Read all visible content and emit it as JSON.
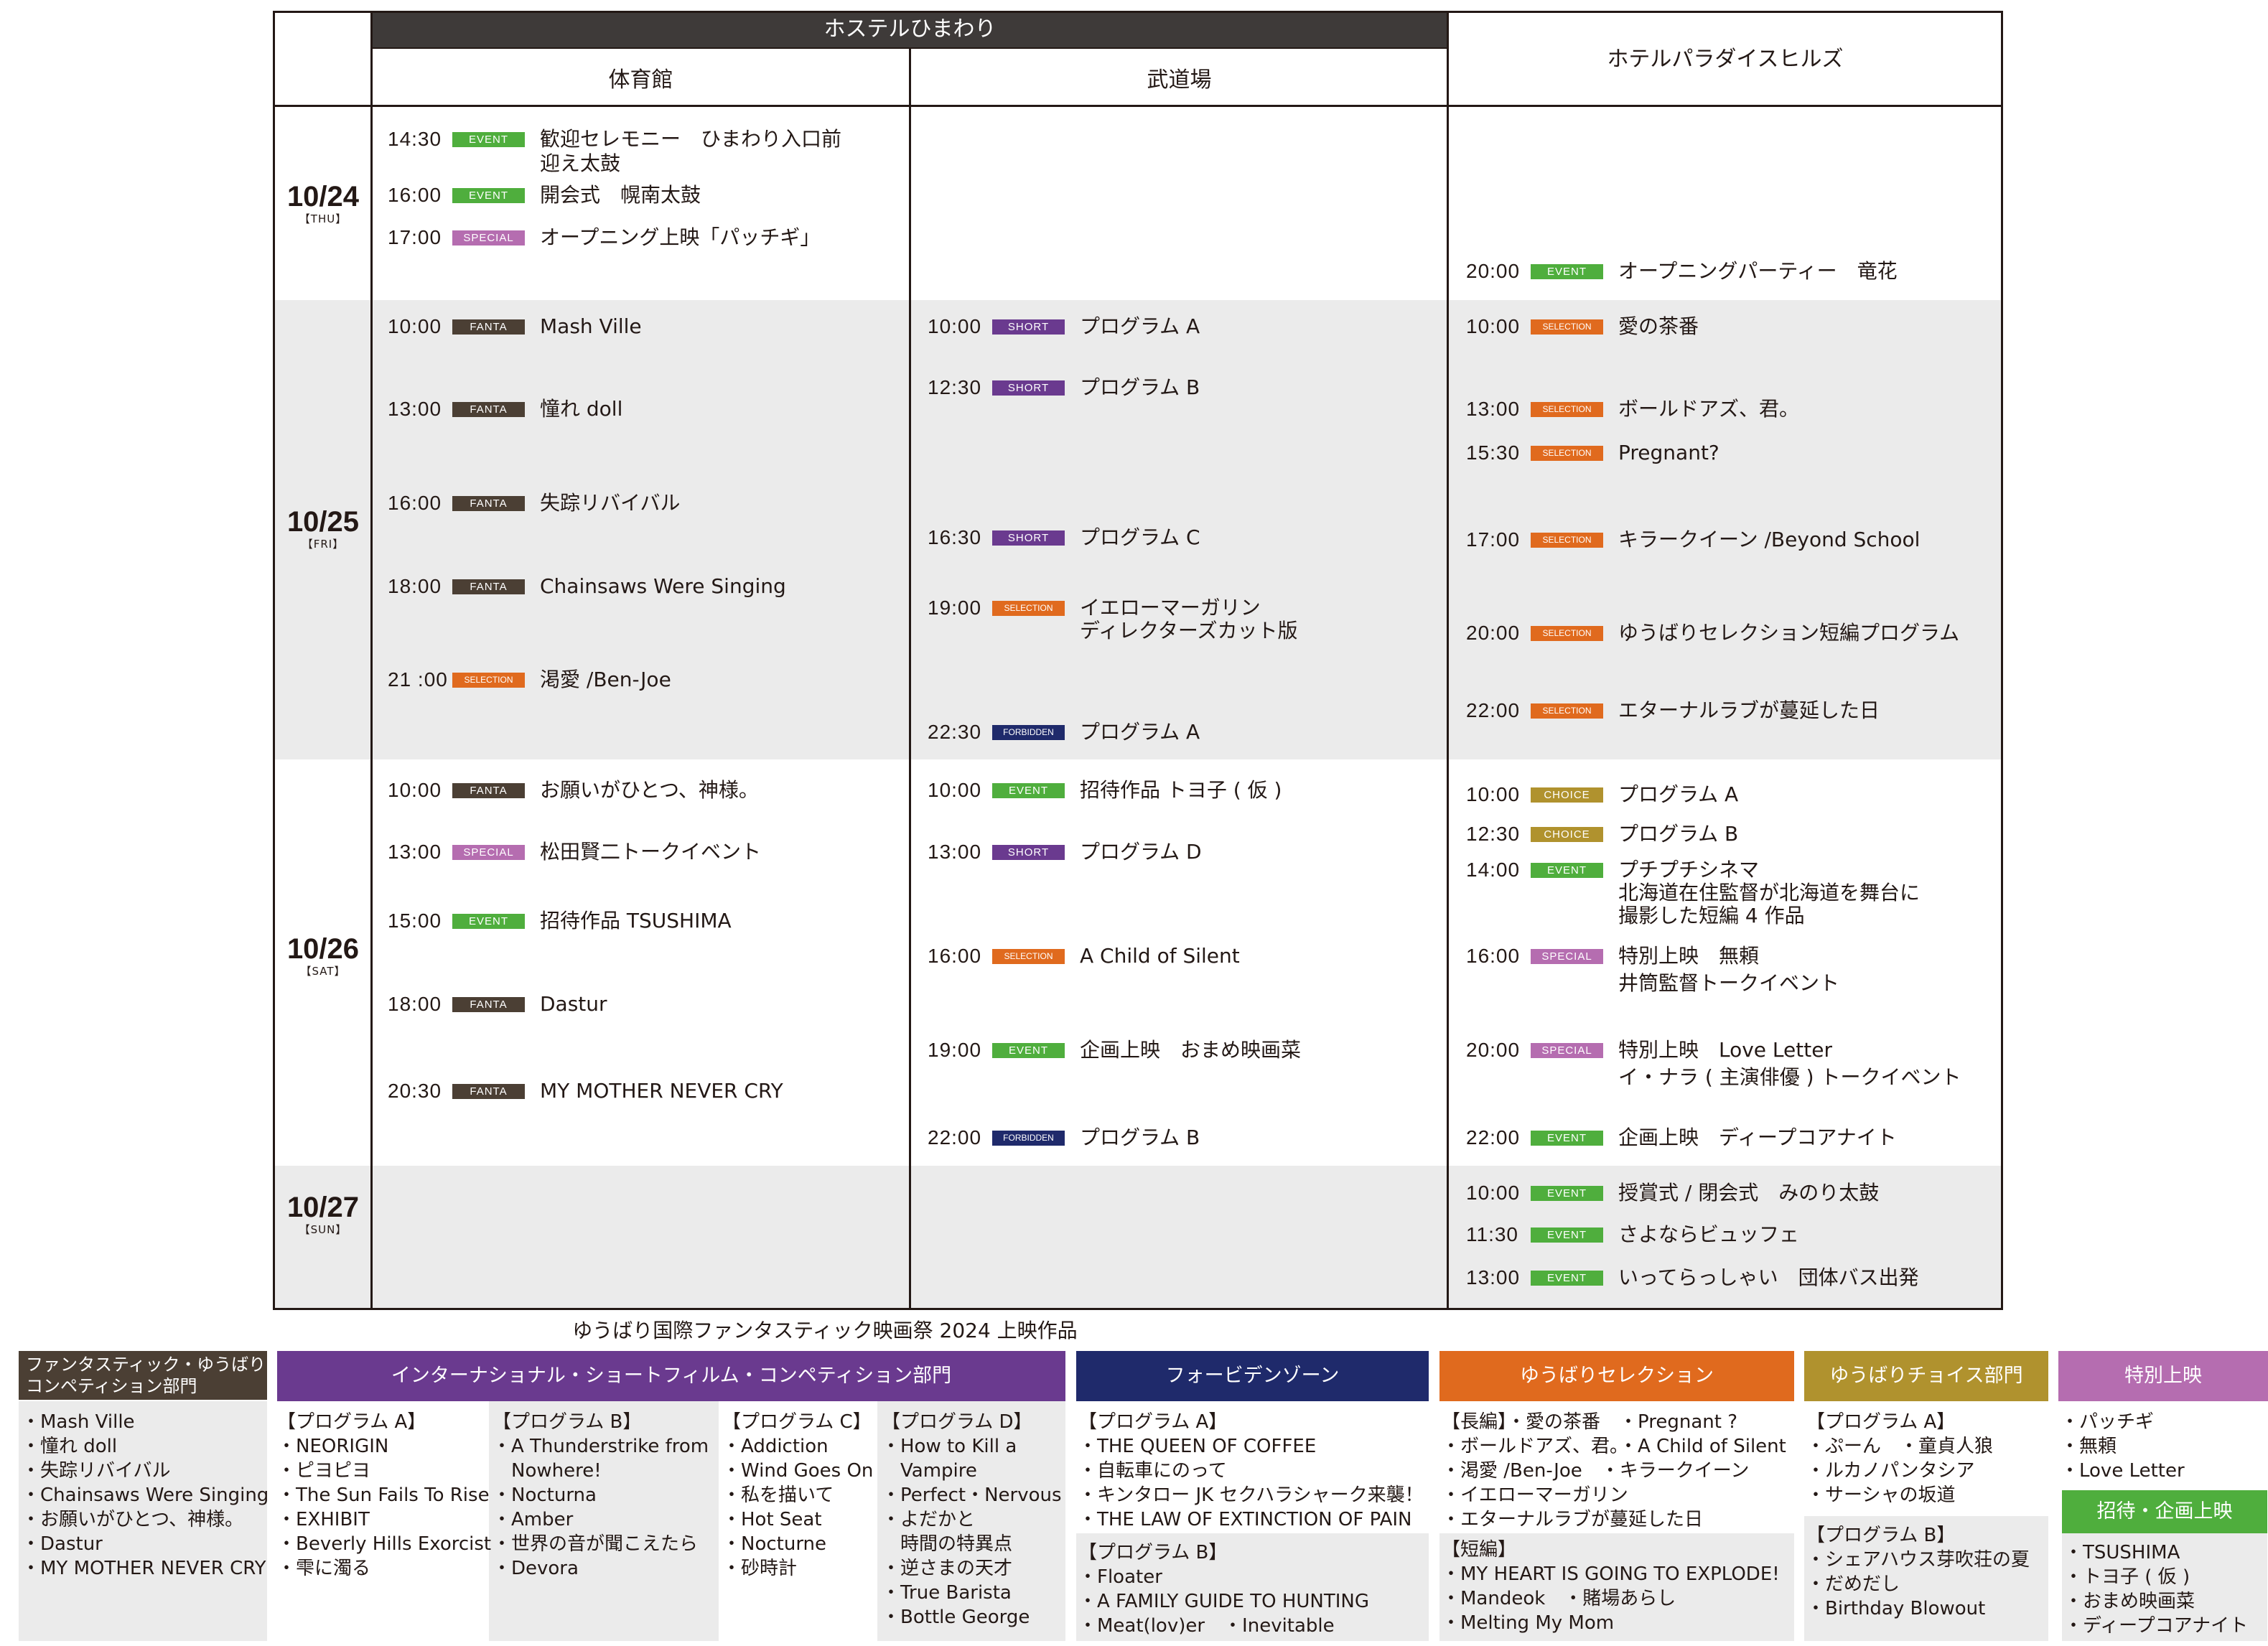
{
  "header": {
    "venue_group": "ホステルひまわり",
    "gym": "体育館",
    "budokan": "武道場",
    "paradise": "ホテルパラダイスヒルズ"
  },
  "colors": {
    "EVENT": "#4fae3d",
    "SPECIAL": "#b56db0",
    "FANTA": "#4b3f34",
    "SHORT": "#6a3a8f",
    "SELECTION": "#e06a1e",
    "FORBIDDEN": "#1f2a6b",
    "CHOICE": "#b0922e"
  },
  "days": [
    {
      "date": "10/24",
      "weekday": "【THU】"
    },
    {
      "date": "10/25",
      "weekday": "【FRI】"
    },
    {
      "date": "10/26",
      "weekday": "【SAT】"
    },
    {
      "date": "10/27",
      "weekday": "【SUN】"
    }
  ],
  "events": [
    {
      "time": "14:30",
      "tag": "EVENT",
      "lines": [
        "歓迎セレモニー　ひまわり入口前",
        "迎え太鼓"
      ]
    },
    {
      "time": "16:00",
      "tag": "EVENT",
      "lines": [
        "開会式　幌南太鼓"
      ]
    },
    {
      "time": "17:00",
      "tag": "SPECIAL",
      "lines": [
        "オープニング上映「パッチギ」"
      ]
    },
    {
      "time": "20:00",
      "tag": "EVENT",
      "lines": [
        "オープニングパーティー　竜花"
      ]
    },
    {
      "time": "10:00",
      "tag": "FANTA",
      "lines": [
        "Mash Ville"
      ]
    },
    {
      "time": "13:00",
      "tag": "FANTA",
      "lines": [
        "憧れ doll"
      ]
    },
    {
      "time": "16:00",
      "tag": "FANTA",
      "lines": [
        "失踪リバイバル"
      ]
    },
    {
      "time": "18:00",
      "tag": "FANTA",
      "lines": [
        "Chainsaws Were Singing"
      ]
    },
    {
      "time": "21 :00",
      "tag": "SELECTION",
      "lines": [
        "渇愛 /Ben-Joe"
      ]
    },
    {
      "time": "10:00",
      "tag": "SHORT",
      "lines": [
        "プログラム A"
      ]
    },
    {
      "time": "12:30",
      "tag": "SHORT",
      "lines": [
        "プログラム B"
      ]
    },
    {
      "time": "16:30",
      "tag": "SHORT",
      "lines": [
        "プログラム C"
      ]
    },
    {
      "time": "19:00",
      "tag": "SELECTION",
      "lines": [
        "イエローマーガリン",
        "ディレクターズカット版"
      ]
    },
    {
      "time": "22:30",
      "tag": "FORBIDDEN",
      "lines": [
        "プログラム A"
      ]
    },
    {
      "time": "10:00",
      "tag": "SELECTION",
      "lines": [
        "愛の茶番"
      ]
    },
    {
      "time": "13:00",
      "tag": "SELECTION",
      "lines": [
        "ボールドアズ、君。"
      ]
    },
    {
      "time": "15:30",
      "tag": "SELECTION",
      "lines": [
        "Pregnant?"
      ]
    },
    {
      "time": "17:00",
      "tag": "SELECTION",
      "lines": [
        "キラークイーン /Beyond School"
      ]
    },
    {
      "time": "20:00",
      "tag": "SELECTION",
      "lines": [
        "ゆうばりセレクション短編プログラム"
      ]
    },
    {
      "time": "22:00",
      "tag": "SELECTION",
      "lines": [
        "エターナルラブが蔓延した日"
      ]
    },
    {
      "time": "10:00",
      "tag": "FANTA",
      "lines": [
        "お願いがひとつ、神様。"
      ]
    },
    {
      "time": "13:00",
      "tag": "SPECIAL",
      "lines": [
        "松田賢二トークイベント"
      ]
    },
    {
      "time": "15:00",
      "tag": "EVENT",
      "lines": [
        "招待作品 TSUSHIMA"
      ]
    },
    {
      "time": "18:00",
      "tag": "FANTA",
      "lines": [
        "Dastur"
      ]
    },
    {
      "time": "20:30",
      "tag": "FANTA",
      "lines": [
        "MY MOTHER NEVER CRY"
      ]
    },
    {
      "time": "10:00",
      "tag": "EVENT",
      "lines": [
        "招待作品 トヨ子 ( 仮 )"
      ]
    },
    {
      "time": "13:00",
      "tag": "SHORT",
      "lines": [
        "プログラム D"
      ]
    },
    {
      "time": "16:00",
      "tag": "SELECTION",
      "lines": [
        "A Child of Silent"
      ]
    },
    {
      "time": "19:00",
      "tag": "EVENT",
      "lines": [
        "企画上映　おまめ映画菜"
      ]
    },
    {
      "time": "22:00",
      "tag": "FORBIDDEN",
      "lines": [
        "プログラム B"
      ]
    },
    {
      "time": "10:00",
      "tag": "CHOICE",
      "lines": [
        "プログラム A"
      ]
    },
    {
      "time": "12:30",
      "tag": "CHOICE",
      "lines": [
        "プログラム B"
      ]
    },
    {
      "time": "14:00",
      "tag": "EVENT",
      "lines": [
        "プチプチシネマ",
        "北海道在住監督が北海道を舞台に",
        "撮影した短編 4 作品"
      ]
    },
    {
      "time": "16:00",
      "tag": "SPECIAL",
      "lines": [
        "特別上映　無頼",
        "井筒監督トークイベント"
      ]
    },
    {
      "time": "20:00",
      "tag": "SPECIAL",
      "lines": [
        "特別上映　Love Letter",
        "イ・ナラ ( 主演俳優 ) トークイベント"
      ]
    },
    {
      "time": "22:00",
      "tag": "EVENT",
      "lines": [
        "企画上映　ディープコアナイト"
      ]
    },
    {
      "time": "10:00",
      "tag": "EVENT",
      "lines": [
        "授賞式 / 閉会式　みのり太鼓"
      ]
    },
    {
      "time": "11:30",
      "tag": "EVENT",
      "lines": [
        "さよならビュッフェ"
      ]
    },
    {
      "time": "13:00",
      "tag": "EVENT",
      "lines": [
        "いってらっしゃい　団体バス出発"
      ]
    }
  ],
  "catalog": {
    "title": "ゆうばり国際ファンタスティック映画祭 2024 上映作品",
    "fanta": {
      "heading_lines": [
        "ファンタスティック・ゆうばり",
        "コンペティション部門"
      ],
      "items": [
        "・Mash Ville",
        "・憧れ doll",
        "・失踪リバイバル",
        "・Chainsaws Were Singing",
        "・お願いがひとつ、神様。",
        "・Dastur",
        "・MY MOTHER NEVER CRY"
      ]
    },
    "short": {
      "heading": "インターナショナル・ショートフィルム・コンペティション部門",
      "programs": [
        {
          "title": "【プログラム A】",
          "items": [
            "・NEORIGIN",
            "・ピヨピヨ",
            "・The Sun Fails To Rise",
            "・EXHIBIT",
            "・Beverly Hills Exorcist",
            "・雫に濁る"
          ]
        },
        {
          "title": "【プログラム B】",
          "items": [
            "・A Thunderstrike from",
            "　Nowhere!",
            "・Nocturna",
            "・Amber",
            "・世界の音が聞こえたら",
            "・Devora"
          ]
        },
        {
          "title": "【プログラム C】",
          "items": [
            "・Addiction",
            "・Wind Goes On",
            "・私を描いて",
            "・Hot Seat",
            "・Nocturne",
            "・砂時計"
          ]
        },
        {
          "title": "【プログラム D】",
          "items": [
            "・How to Kill a",
            "　Vampire",
            "・Perfect・Nervous",
            "・よだかと",
            "　時間の特異点",
            "・逆さまの天才",
            "・True Barista",
            "・Bottle George"
          ]
        }
      ]
    },
    "forbidden": {
      "heading": "フォービデンゾーン",
      "program_a": {
        "title": "【プログラム A】",
        "items": [
          "・THE QUEEN OF COFFEE",
          "・自転車にのって",
          "・キンタロー JK セクハラシャーク来襲！",
          "・THE LAW OF EXTINCTION OF PAIN"
        ]
      },
      "program_b": {
        "title": "【プログラム B】",
        "items": [
          "・Floater",
          "・A FAMILY GUIDE TO HUNTING",
          "・Meat(lov)er　・Inevitable"
        ]
      }
    },
    "selection": {
      "heading": "ゆうばりセレクション",
      "long": [
        "【長編】・愛の茶番　・Pregnant ?",
        "・ボールドアズ、君。・A Child of Silent",
        "・渇愛 /Ben-Joe　・キラークイーン",
        "・イエローマーガリン",
        "・エターナルラブが蔓延した日"
      ],
      "short": [
        "【短編】",
        "・MY HEART IS GOING TO EXPLODE!",
        "・Mandeok　・賭場あらし",
        "・Melting My Mom"
      ]
    },
    "choice": {
      "heading": "ゆうばりチョイス部門",
      "program_a": {
        "title": "【プログラム A】",
        "items": [
          "・ぷーん　・童貞人狼",
          "・ルカノパンタシア",
          "・サーシャの坂道"
        ]
      },
      "program_b": {
        "title": "【プログラム B】",
        "items": [
          "・シェアハウス芽吹荘の夏",
          "・だめだし",
          "・Birthday Blowout"
        ]
      }
    },
    "special": {
      "heading": "特別上映",
      "items": [
        "・パッチギ",
        "・無頼",
        "・Love Letter"
      ],
      "invite_heading": "招待・企画上映",
      "invite_items": [
        "・TSUSHIMA",
        "・トヨ子 ( 仮 )",
        "・おまめ映画菜",
        "・ディープコアナイト"
      ]
    }
  }
}
